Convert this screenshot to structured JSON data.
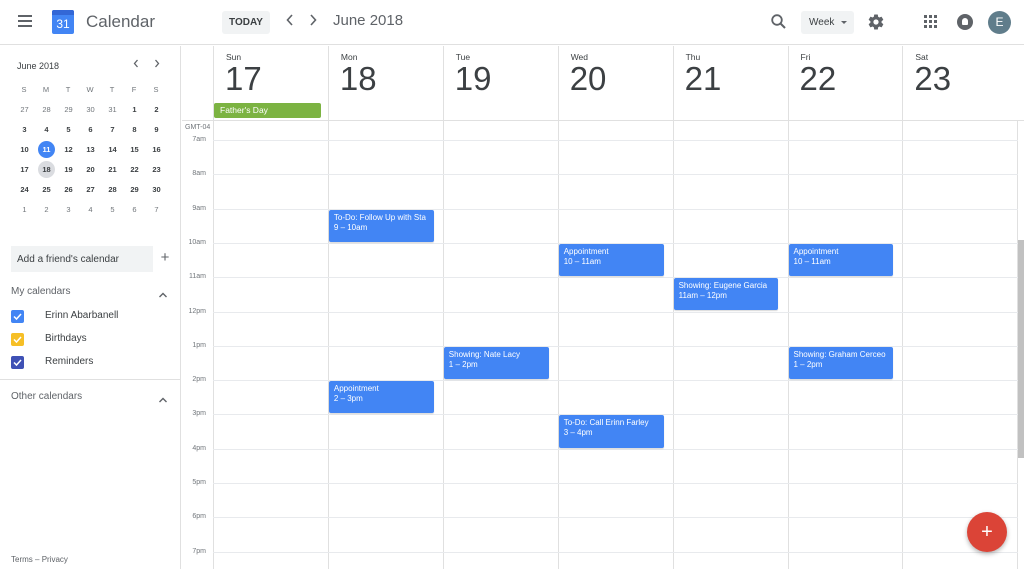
{
  "header": {
    "app_title": "Calendar",
    "logo_day": "31",
    "today_label": "TODAY",
    "prev_icon": "chevron-left-icon",
    "next_icon": "chevron-right-icon",
    "month_title": "June 2018",
    "view_selected": "Week",
    "avatar_initial": "E"
  },
  "mini_calendar": {
    "title": "June 2018",
    "weekdays": [
      "S",
      "M",
      "T",
      "W",
      "T",
      "F",
      "S"
    ],
    "weeks": [
      [
        {
          "d": "27",
          "o": true
        },
        {
          "d": "28",
          "o": true
        },
        {
          "d": "29",
          "o": true
        },
        {
          "d": "30",
          "o": true
        },
        {
          "d": "31",
          "o": true
        },
        {
          "d": "1"
        },
        {
          "d": "2"
        }
      ],
      [
        {
          "d": "3"
        },
        {
          "d": "4"
        },
        {
          "d": "5"
        },
        {
          "d": "6"
        },
        {
          "d": "7"
        },
        {
          "d": "8"
        },
        {
          "d": "9"
        }
      ],
      [
        {
          "d": "10"
        },
        {
          "d": "11",
          "today": true
        },
        {
          "d": "12"
        },
        {
          "d": "13"
        },
        {
          "d": "14"
        },
        {
          "d": "15"
        },
        {
          "d": "16"
        }
      ],
      [
        {
          "d": "17"
        },
        {
          "d": "18",
          "selected": true
        },
        {
          "d": "19"
        },
        {
          "d": "20"
        },
        {
          "d": "21"
        },
        {
          "d": "22"
        },
        {
          "d": "23"
        }
      ],
      [
        {
          "d": "24"
        },
        {
          "d": "25"
        },
        {
          "d": "26"
        },
        {
          "d": "27"
        },
        {
          "d": "28"
        },
        {
          "d": "29"
        },
        {
          "d": "30"
        }
      ],
      [
        {
          "d": "1",
          "o": true
        },
        {
          "d": "2",
          "o": true
        },
        {
          "d": "3",
          "o": true
        },
        {
          "d": "4",
          "o": true
        },
        {
          "d": "5",
          "o": true
        },
        {
          "d": "6",
          "o": true
        },
        {
          "d": "7",
          "o": true
        }
      ]
    ]
  },
  "sidebar": {
    "friend_placeholder": "Add a friend's calendar",
    "my_calendars_label": "My calendars",
    "other_calendars_label": "Other calendars",
    "calendars": [
      {
        "name": "Erinn Abarbanell",
        "color": "#4285f4",
        "checked": true
      },
      {
        "name": "Birthdays",
        "color": "#f6bf26",
        "checked": true
      },
      {
        "name": "Reminders",
        "color": "#3f51b5",
        "checked": true
      }
    ],
    "footer_terms": "Terms",
    "footer_sep": " – ",
    "footer_privacy": "Privacy"
  },
  "week": {
    "timezone": "GMT-04",
    "days": [
      {
        "name": "Sun",
        "num": "17"
      },
      {
        "name": "Mon",
        "num": "18"
      },
      {
        "name": "Tue",
        "num": "19"
      },
      {
        "name": "Wed",
        "num": "20"
      },
      {
        "name": "Thu",
        "num": "21"
      },
      {
        "name": "Fri",
        "num": "22"
      },
      {
        "name": "Sat",
        "num": "23"
      }
    ],
    "all_day_events": [
      {
        "day": 0,
        "title": "Father's Day",
        "color": "#7cb342"
      }
    ],
    "hours": [
      "7am",
      "8am",
      "9am",
      "10am",
      "11am",
      "12pm",
      "1pm",
      "2pm",
      "3pm",
      "4pm",
      "5pm",
      "6pm",
      "7pm"
    ],
    "first_hour": 7,
    "events": [
      {
        "day": 1,
        "start": 9,
        "end": 10,
        "title": "To-Do: Follow Up with Sta",
        "time": "9 – 10am"
      },
      {
        "day": 3,
        "start": 10,
        "end": 11,
        "title": "Appointment",
        "time": "10 – 11am"
      },
      {
        "day": 5,
        "start": 10,
        "end": 11,
        "title": "Appointment",
        "time": "10 – 11am"
      },
      {
        "day": 4,
        "start": 11,
        "end": 12,
        "title": "Showing: Eugene Garcia",
        "time": "11am – 12pm"
      },
      {
        "day": 2,
        "start": 13,
        "end": 14,
        "title": "Showing: Nate Lacy",
        "time": "1 – 2pm"
      },
      {
        "day": 5,
        "start": 13,
        "end": 14,
        "title": "Showing: Graham Cerceo",
        "time": "1 – 2pm"
      },
      {
        "day": 1,
        "start": 14,
        "end": 15,
        "title": "Appointment",
        "time": "2 – 3pm"
      },
      {
        "day": 3,
        "start": 15,
        "end": 16,
        "title": "To-Do: Call Erinn Farley",
        "time": "3 – 4pm"
      }
    ],
    "event_color": "#4285f4"
  },
  "fab": {
    "label": "+",
    "color": "#db4437"
  }
}
